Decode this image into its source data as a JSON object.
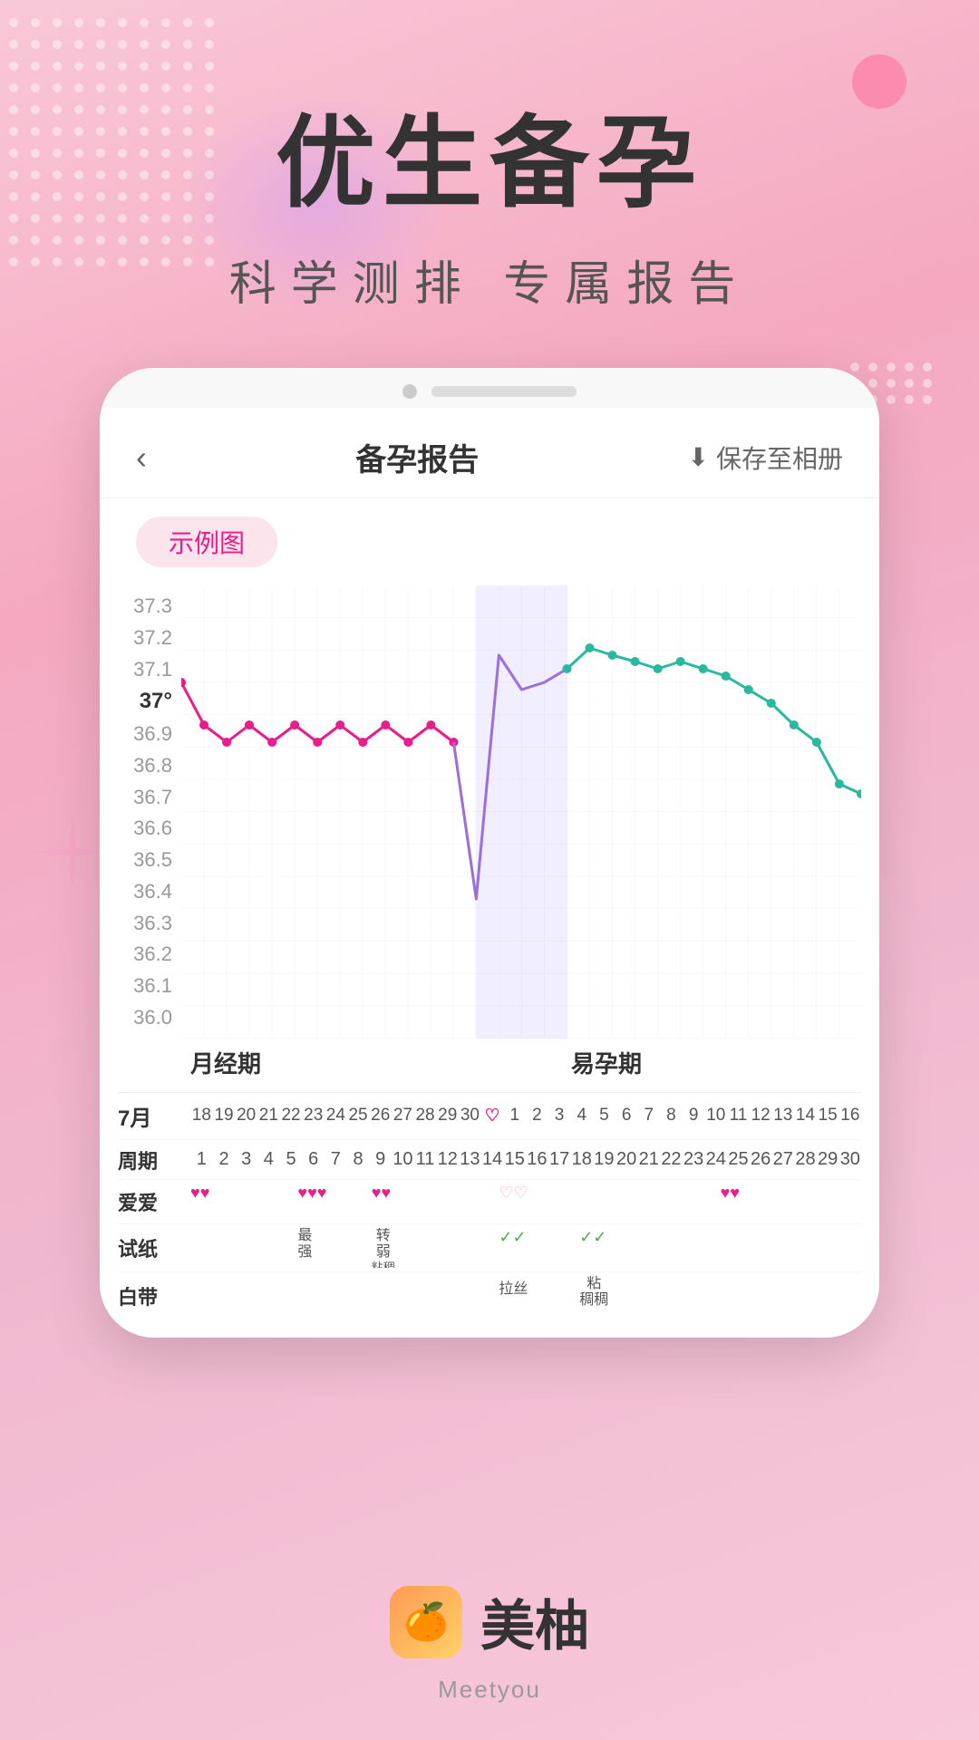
{
  "background": {
    "color_start": "#f9c8d8",
    "color_end": "#f8c8dc"
  },
  "hero": {
    "title": "优生备孕",
    "subtitle": "科学测排   专属报告"
  },
  "phone": {
    "header": {
      "back_label": "‹",
      "title": "备孕报告",
      "save_icon": "⬇",
      "save_label": "保存至相册"
    },
    "sample_badge": "示例图",
    "chart": {
      "y_labels": [
        "37.3",
        "37.2",
        "37.1",
        "37°",
        "36.9",
        "36.8",
        "36.7",
        "36.6",
        "36.5",
        "36.4",
        "36.3",
        "36.2",
        "36.1",
        "36.0"
      ],
      "phases": {
        "menstrual": "月经期",
        "fertile": "易孕期"
      }
    },
    "calendar": {
      "month": "7月",
      "dates": [
        "18",
        "19",
        "20",
        "21",
        "22",
        "23",
        "24",
        "25",
        "26",
        "27",
        "28",
        "29",
        "30",
        "♡",
        "1",
        "2",
        "3",
        "4",
        "5",
        "6",
        "7",
        "8",
        "9",
        "10",
        "11",
        "12",
        "13",
        "14",
        "15",
        "16"
      ],
      "week_label": "周期",
      "week_values": [
        "1",
        "2",
        "3",
        "4",
        "5",
        "6",
        "7",
        "8",
        "9",
        "10",
        "11",
        "12",
        "13",
        "14",
        "15",
        "16",
        "17",
        "18",
        "19",
        "20",
        "21",
        "22",
        "23",
        "24",
        "25",
        "26",
        "27",
        "28",
        "29",
        "30"
      ]
    },
    "rows": {
      "love_label": "爱爱",
      "love_marks": [
        {
          "pos": 0,
          "type": "filled2"
        },
        {
          "pos": 5,
          "type": "filled3"
        },
        {
          "pos": 8,
          "type": "filled2"
        },
        {
          "pos": 14,
          "type": "empty2"
        },
        {
          "pos": 24,
          "type": "filled2"
        }
      ],
      "test_label": "试纸",
      "test_marks": [
        {
          "pos": 5,
          "text": "最强"
        },
        {
          "pos": 8,
          "text": "转弱"
        },
        {
          "pos": 14,
          "text": "✓✓",
          "color": "green"
        },
        {
          "pos": 18,
          "text": "✓✓",
          "color": "green"
        }
      ],
      "discharge_label": "白带",
      "discharge_marks": [
        {
          "pos": 8,
          "text": "粘稠"
        },
        {
          "pos": 14,
          "text": "拉丝"
        },
        {
          "pos": 18,
          "text": "粘稠"
        }
      ]
    }
  },
  "logo": {
    "icon_emoji": "🍊",
    "name": "美柚",
    "brand": "Meetyou"
  }
}
